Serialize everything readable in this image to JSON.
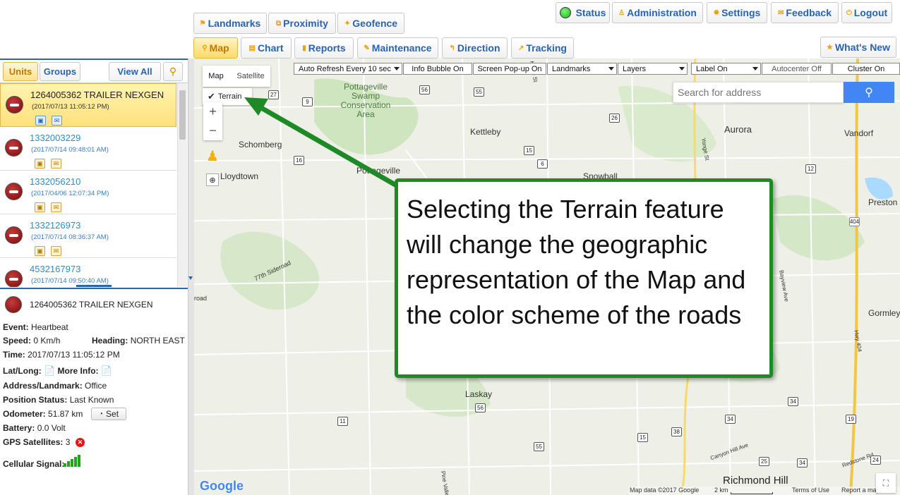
{
  "top_nav": {
    "landmarks": "Landmarks",
    "proximity": "Proximity",
    "geofence": "Geofence",
    "status": "Status",
    "administration": "Administration",
    "settings": "Settings",
    "feedback": "Feedback",
    "logout": "Logout"
  },
  "tabs": [
    "Map",
    "Chart",
    "Reports",
    "Maintenance",
    "Direction",
    "Tracking"
  ],
  "whats_new": "What's New",
  "sidebar": {
    "tab_units": "Units",
    "tab_groups": "Groups",
    "view_all": "View All"
  },
  "units": [
    {
      "name": "1264005362 TRAILER NEXGEN",
      "date": "(2017/07/13 11:05:12 PM)"
    },
    {
      "name": "1332003229",
      "date": "(2017/07/14 09:48:01 AM)"
    },
    {
      "name": "1332056210",
      "date": "(2017/04/06 12:07:34 PM)"
    },
    {
      "name": "1332126973",
      "date": "(2017/07/14 08:36:37 AM)"
    },
    {
      "name": "4532167973",
      "date": "(2017/07/14 09:50:40 AM)"
    }
  ],
  "details": {
    "unit_name": "1264005362 TRAILER NEXGEN",
    "event_label": "Event:",
    "event": "Heartbeat",
    "speed_label": "Speed:",
    "speed": "0 Km/h",
    "heading_label": "Heading:",
    "heading": "NORTH EAST",
    "time_label": "Time:",
    "time": "2017/07/13 11:05:12 PM",
    "latlong_label": "Lat/Long:",
    "more_info_label": "More Info:",
    "address_label": "Address/Landmark:",
    "address": "Office",
    "position_label": "Position Status:",
    "position": "Last Known",
    "odometer_label": "Odometer:",
    "odometer": "51.87 km",
    "set_button": "Set",
    "battery_label": "Battery:",
    "battery": "0.0 Volt",
    "gps_label": "GPS Satellites:",
    "gps": "3",
    "cellular_label": "Cellular Signal:"
  },
  "map_toolbar": {
    "auto_refresh": "Auto Refresh Every 10 sec",
    "info_bubble": "Info Bubble On",
    "screen_popup": "Screen Pop-up On",
    "landmarks": "Landmarks",
    "layers": "Layers",
    "label": "Label On",
    "autocenter": "Autocenter Off",
    "cluster": "Cluster On"
  },
  "map_type": {
    "map": "Map",
    "satellite": "Satellite",
    "terrain": "Terrain"
  },
  "search": {
    "placeholder": "Search for address"
  },
  "places": [
    "Pottageville Swamp Conservation Area",
    "Kettleby",
    "Schomberg",
    "Lloydtown",
    "Pottageville",
    "Aurora",
    "Vandorf",
    "Preston Lak",
    "Gormley",
    "Laskay",
    "Richmond Hill",
    "77th Sideroad",
    "Keele St",
    "Yonge St",
    "Bayview Ave",
    "Hwy 404",
    "Canyon Hill Ave",
    "Redstone Rd",
    "Pine Valley",
    "Snowball",
    "road"
  ],
  "road_shields": [
    "27",
    "9",
    "56",
    "55",
    "26",
    "15",
    "16",
    "6",
    "12",
    "404",
    "56",
    "34",
    "11",
    "55",
    "38",
    "15",
    "34",
    "19",
    "34",
    "25",
    "24"
  ],
  "footer": {
    "google": "Google",
    "map_data": "Map data ©2017 Google",
    "scale": "2 km",
    "terms": "Terms of Use",
    "report": "Report a map error"
  },
  "annotation": "Selecting the Terrain feature will change the geographic representation of the Map and the color scheme of the roads",
  "colors": {
    "accent_green": "#1e8a26",
    "nav_blue": "#2a63b0",
    "active_gold": "#ffd96a",
    "status_green": "#1db81d"
  }
}
